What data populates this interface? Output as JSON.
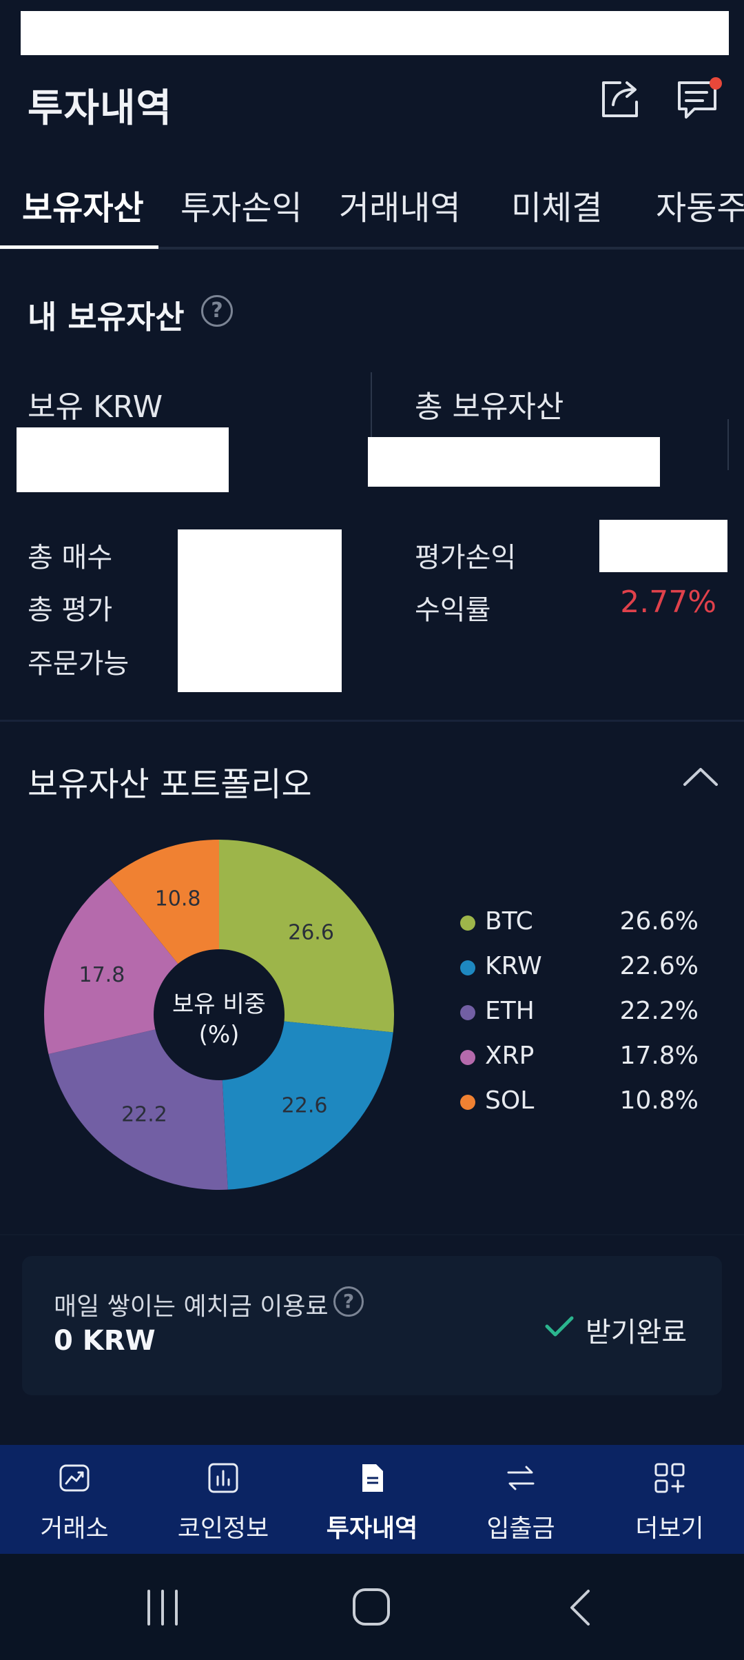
{
  "header": {
    "title": "투자내역",
    "share_icon": "share-icon",
    "notice_icon": "message-icon"
  },
  "tabs": [
    {
      "label": "보유자산",
      "active": true
    },
    {
      "label": "투자손익",
      "active": false
    },
    {
      "label": "거래내역",
      "active": false
    },
    {
      "label": "미체결",
      "active": false
    },
    {
      "label": "자동주문",
      "active": false
    }
  ],
  "assets": {
    "title": "내 보유자산",
    "krw_label": "보유 KRW",
    "total_label": "총 보유자산",
    "buy_label": "총 매수",
    "eval_label": "총 평가",
    "orderable_label": "주문가능",
    "pnl_label": "평가손익",
    "rate_label": "수익률",
    "rate_value": "2.77%"
  },
  "portfolio": {
    "title": "보유자산 포트폴리오",
    "center_label_1": "보유 비중",
    "center_label_2": "(%)"
  },
  "chart_data": {
    "type": "pie",
    "categories": [
      "BTC",
      "KRW",
      "ETH",
      "XRP",
      "SOL"
    ],
    "values": [
      26.6,
      22.6,
      22.2,
      17.8,
      10.8
    ],
    "value_labels": [
      "26.6",
      "22.6",
      "22.2",
      "17.8",
      "10.8"
    ],
    "legend_values": [
      "26.6%",
      "22.6%",
      "22.2%",
      "17.8%",
      "10.8%"
    ],
    "colors": [
      "#9db54a",
      "#1e88c0",
      "#725fa4",
      "#b56aac",
      "#f08132"
    ],
    "donut": true,
    "legend_placement": "right"
  },
  "fee": {
    "title": "매일 쌓이는 예치금 이용료",
    "amount": "0 KRW",
    "status": "받기완료",
    "status_color": "#2bb58e"
  },
  "bottom_nav": [
    {
      "label": "거래소",
      "icon": "chart-trend-icon",
      "active": false
    },
    {
      "label": "코인정보",
      "icon": "bar-chart-icon",
      "active": false
    },
    {
      "label": "투자내역",
      "icon": "document-icon",
      "active": true
    },
    {
      "label": "입출금",
      "icon": "transfer-icon",
      "active": false
    },
    {
      "label": "더보기",
      "icon": "grid-plus-icon",
      "active": false
    }
  ]
}
